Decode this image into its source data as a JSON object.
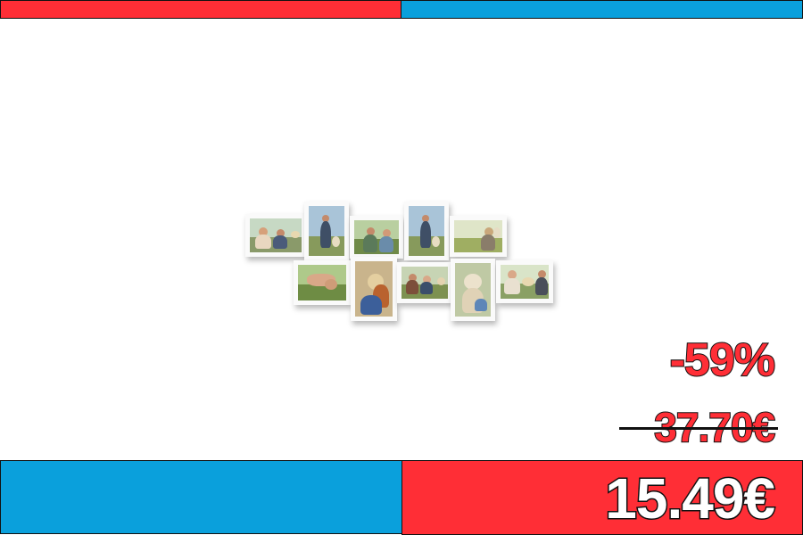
{
  "colors": {
    "brand_red": "#ff2e36",
    "brand_blue": "#0aa0dc",
    "text_white": "#ffffff",
    "outline": "#111111"
  },
  "product": {
    "image_description_icon": "photo-collage-frame-icon",
    "frame_count": 10
  },
  "pricing": {
    "discount": "-59%",
    "old_price": "37.70€",
    "new_price": "15.49€"
  }
}
